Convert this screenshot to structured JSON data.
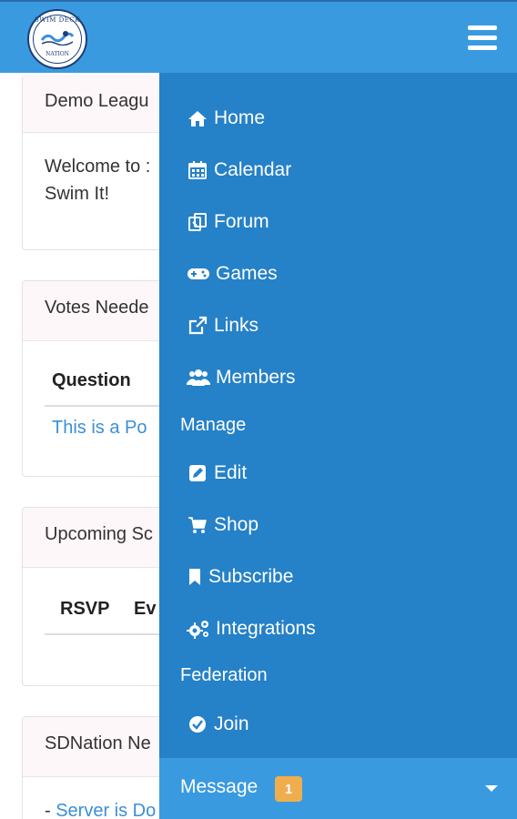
{
  "header": {
    "logo_text_top": "SWIM DECK",
    "logo_text_bottom": "NATION",
    "menu_icon": "hamburger-icon"
  },
  "cards": [
    {
      "title": "Demo Leagu",
      "body_line1": "Welcome to :",
      "body_line2": "Swim It!"
    },
    {
      "title": "Votes Neede",
      "column": "Question",
      "row_link": "This is a Po"
    },
    {
      "title": "Upcoming Sc",
      "columns": [
        "RSVP",
        "Ev"
      ]
    },
    {
      "title": "SDNation Ne",
      "item_prefix": "- ",
      "item_link": "Server is Do"
    }
  ],
  "menu": {
    "items": [
      {
        "label": "Home",
        "icon": "home-icon"
      },
      {
        "label": "Calendar",
        "icon": "calendar-icon"
      },
      {
        "label": "Forum",
        "icon": "forum-icon"
      },
      {
        "label": "Games",
        "icon": "gamepad-icon"
      },
      {
        "label": "Links",
        "icon": "external-link-icon"
      },
      {
        "label": "Members",
        "icon": "users-icon"
      }
    ],
    "manage_heading": "Manage",
    "manage_items": [
      {
        "label": "Edit",
        "icon": "edit-icon"
      },
      {
        "label": "Shop",
        "icon": "cart-icon"
      },
      {
        "label": "Subscribe",
        "icon": "bookmark-icon"
      },
      {
        "label": "Integrations",
        "icon": "gears-icon"
      }
    ],
    "federation_heading": "Federation",
    "federation_items": [
      {
        "label": "Join",
        "icon": "check-circle-icon"
      }
    ],
    "message": {
      "label": "Message",
      "badge": "1"
    }
  },
  "colors": {
    "topbar": "#3a9ae0",
    "menu_bg": "#2581c8",
    "badge": "#f0ad4e",
    "link": "#3a8fd8"
  }
}
